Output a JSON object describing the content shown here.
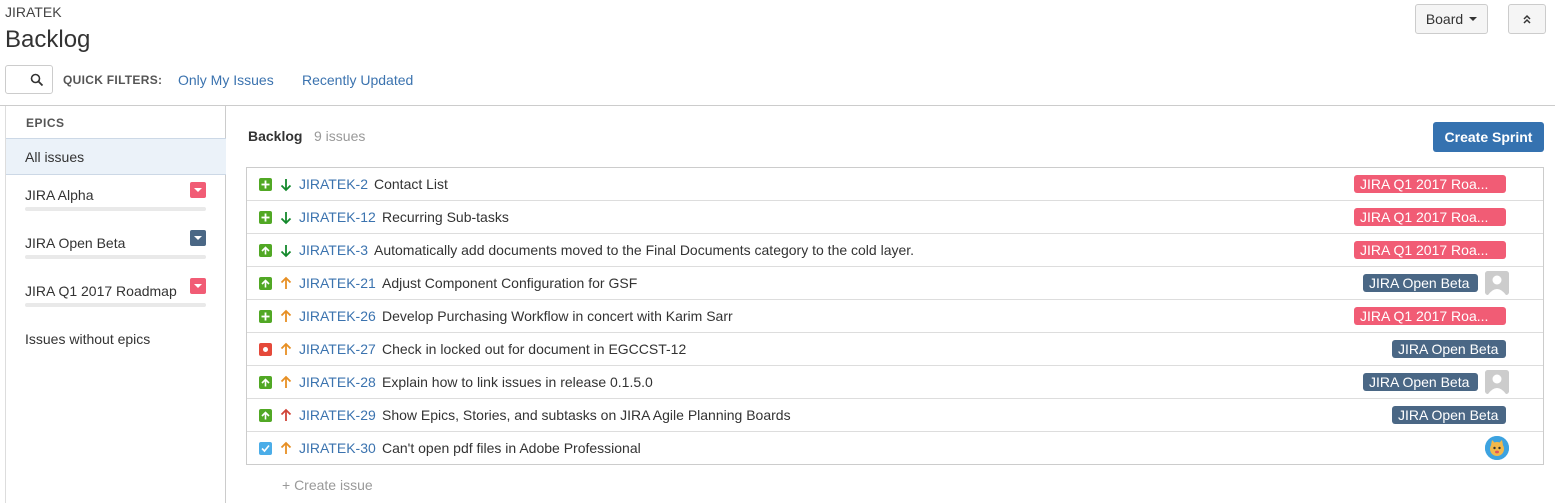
{
  "header": {
    "project_key": "JIRATEK",
    "title": "Backlog",
    "board_button": "Board"
  },
  "quick_filters": {
    "label": "QUICK FILTERS:",
    "items": [
      "Only My Issues",
      "Recently Updated"
    ]
  },
  "sidebar": {
    "title": "EPICS",
    "all_issues": "All issues",
    "epics": [
      {
        "name": "JIRA Alpha",
        "color": "#f15c75"
      },
      {
        "name": "JIRA Open Beta",
        "color": "#4a6785"
      },
      {
        "name": "JIRA Q1 2017 Roadmap",
        "color": "#f15c75"
      }
    ],
    "issues_without_epics": "Issues without epics"
  },
  "backlog": {
    "title": "Backlog",
    "count": "9 issues",
    "create_sprint": "Create Sprint",
    "create_issue": "+ Create issue",
    "issues": [
      {
        "key": "JIRATEK-2",
        "summary": "Contact List",
        "type": "new-feature",
        "priority": "low",
        "epic": "JIRA Q1 2017 Roa...",
        "epic_color": "#f15c75",
        "avatar": ""
      },
      {
        "key": "JIRATEK-12",
        "summary": "Recurring Sub-tasks",
        "type": "new-feature",
        "priority": "low",
        "epic": "JIRA Q1 2017 Roa...",
        "epic_color": "#f15c75",
        "avatar": ""
      },
      {
        "key": "JIRATEK-3",
        "summary": "Automatically add documents moved to the Final Documents category to the cold layer.",
        "type": "improvement",
        "priority": "low",
        "epic": "JIRA Q1 2017 Roa...",
        "epic_color": "#f15c75",
        "avatar": ""
      },
      {
        "key": "JIRATEK-21",
        "summary": "Adjust Component Configuration for GSF",
        "type": "improvement",
        "priority": "medium",
        "epic": "JIRA Open Beta",
        "epic_color": "#4a6785",
        "avatar": "default"
      },
      {
        "key": "JIRATEK-26",
        "summary": "Develop Purchasing Workflow in concert with Karim Sarr",
        "type": "new-feature",
        "priority": "medium",
        "epic": "JIRA Q1 2017 Roa...",
        "epic_color": "#f15c75",
        "avatar": ""
      },
      {
        "key": "JIRATEK-27",
        "summary": "Check in locked out for document in EGCCST-12",
        "type": "bug",
        "priority": "medium",
        "epic": "JIRA Open Beta",
        "epic_color": "#4a6785",
        "avatar": ""
      },
      {
        "key": "JIRATEK-28",
        "summary": "Explain how to link issues in release 0.1.5.0",
        "type": "improvement",
        "priority": "medium",
        "epic": "JIRA Open Beta",
        "epic_color": "#4a6785",
        "avatar": "default"
      },
      {
        "key": "JIRATEK-29",
        "summary": "Show Epics, Stories, and subtasks on JIRA Agile Planning Boards",
        "type": "improvement",
        "priority": "high",
        "epic": "JIRA Open Beta",
        "epic_color": "#4a6785",
        "avatar": ""
      },
      {
        "key": "JIRATEK-30",
        "summary": "Can't open pdf files in Adobe Professional",
        "type": "task",
        "priority": "medium",
        "epic": "",
        "epic_color": "",
        "avatar": "cat"
      }
    ]
  }
}
